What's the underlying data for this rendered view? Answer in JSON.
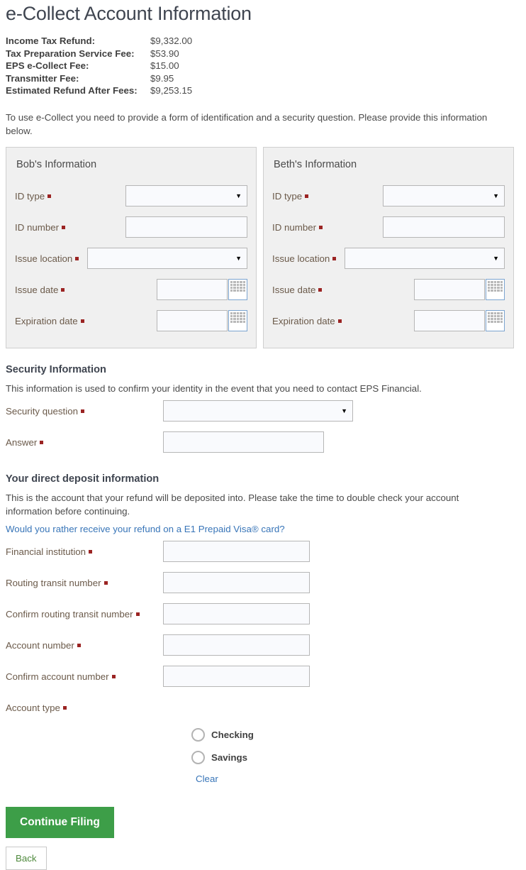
{
  "page_title": "e-Collect Account Information",
  "fees": [
    {
      "label": "Income Tax Refund:",
      "value": "$9,332.00"
    },
    {
      "label": "Tax Preparation Service Fee:",
      "value": "$53.90"
    },
    {
      "label": "EPS e-Collect Fee:",
      "value": "$15.00"
    },
    {
      "label": "Transmitter Fee:",
      "value": "$9.95"
    },
    {
      "label": "Estimated Refund After Fees:",
      "value": "$9,253.15"
    }
  ],
  "intro": "To use e-Collect you need to provide a form of identification and a security question. Please provide this information below.",
  "id_panels": [
    {
      "title": "Bob's Information",
      "id_type_label": "ID type",
      "id_type_value": "",
      "id_number_label": "ID number",
      "id_number_value": "",
      "issue_location_label": "Issue location",
      "issue_location_value": "",
      "issue_date_label": "Issue date",
      "issue_date_value": "",
      "expiration_date_label": "Expiration date",
      "expiration_date_value": ""
    },
    {
      "title": "Beth's Information",
      "id_type_label": "ID type",
      "id_type_value": "",
      "id_number_label": "ID number",
      "id_number_value": "",
      "issue_location_label": "Issue location",
      "issue_location_value": "",
      "issue_date_label": "Issue date",
      "issue_date_value": "",
      "expiration_date_label": "Expiration date",
      "expiration_date_value": ""
    }
  ],
  "security": {
    "title": "Security Information",
    "description": "This information is used to confirm your identity in the event that you need to contact EPS Financial.",
    "question_label": "Security question",
    "question_value": "",
    "answer_label": "Answer",
    "answer_value": ""
  },
  "deposit": {
    "title": "Your direct deposit information",
    "description": "This is the account that your refund will be deposited into. Please take the time to double check your account information before continuing.",
    "prepaid_link": "Would you rather receive your refund on a E1 Prepaid Visa® card?",
    "fields": [
      {
        "label": "Financial institution",
        "value": ""
      },
      {
        "label": "Routing transit number",
        "value": ""
      },
      {
        "label": "Confirm routing transit number",
        "value": ""
      },
      {
        "label": "Account number",
        "value": ""
      },
      {
        "label": "Confirm account number",
        "value": ""
      }
    ],
    "account_type_label": "Account type",
    "account_type_options": [
      "Checking",
      "Savings"
    ],
    "account_type_selected": "",
    "clear_label": "Clear"
  },
  "buttons": {
    "continue_label": "Continue Filing",
    "back_label": "Back"
  },
  "colors": {
    "accent_green": "#3d9e48",
    "link_blue": "#3875b8",
    "required_dot": "#9b2423",
    "panel_bg": "#f0f0f0"
  }
}
